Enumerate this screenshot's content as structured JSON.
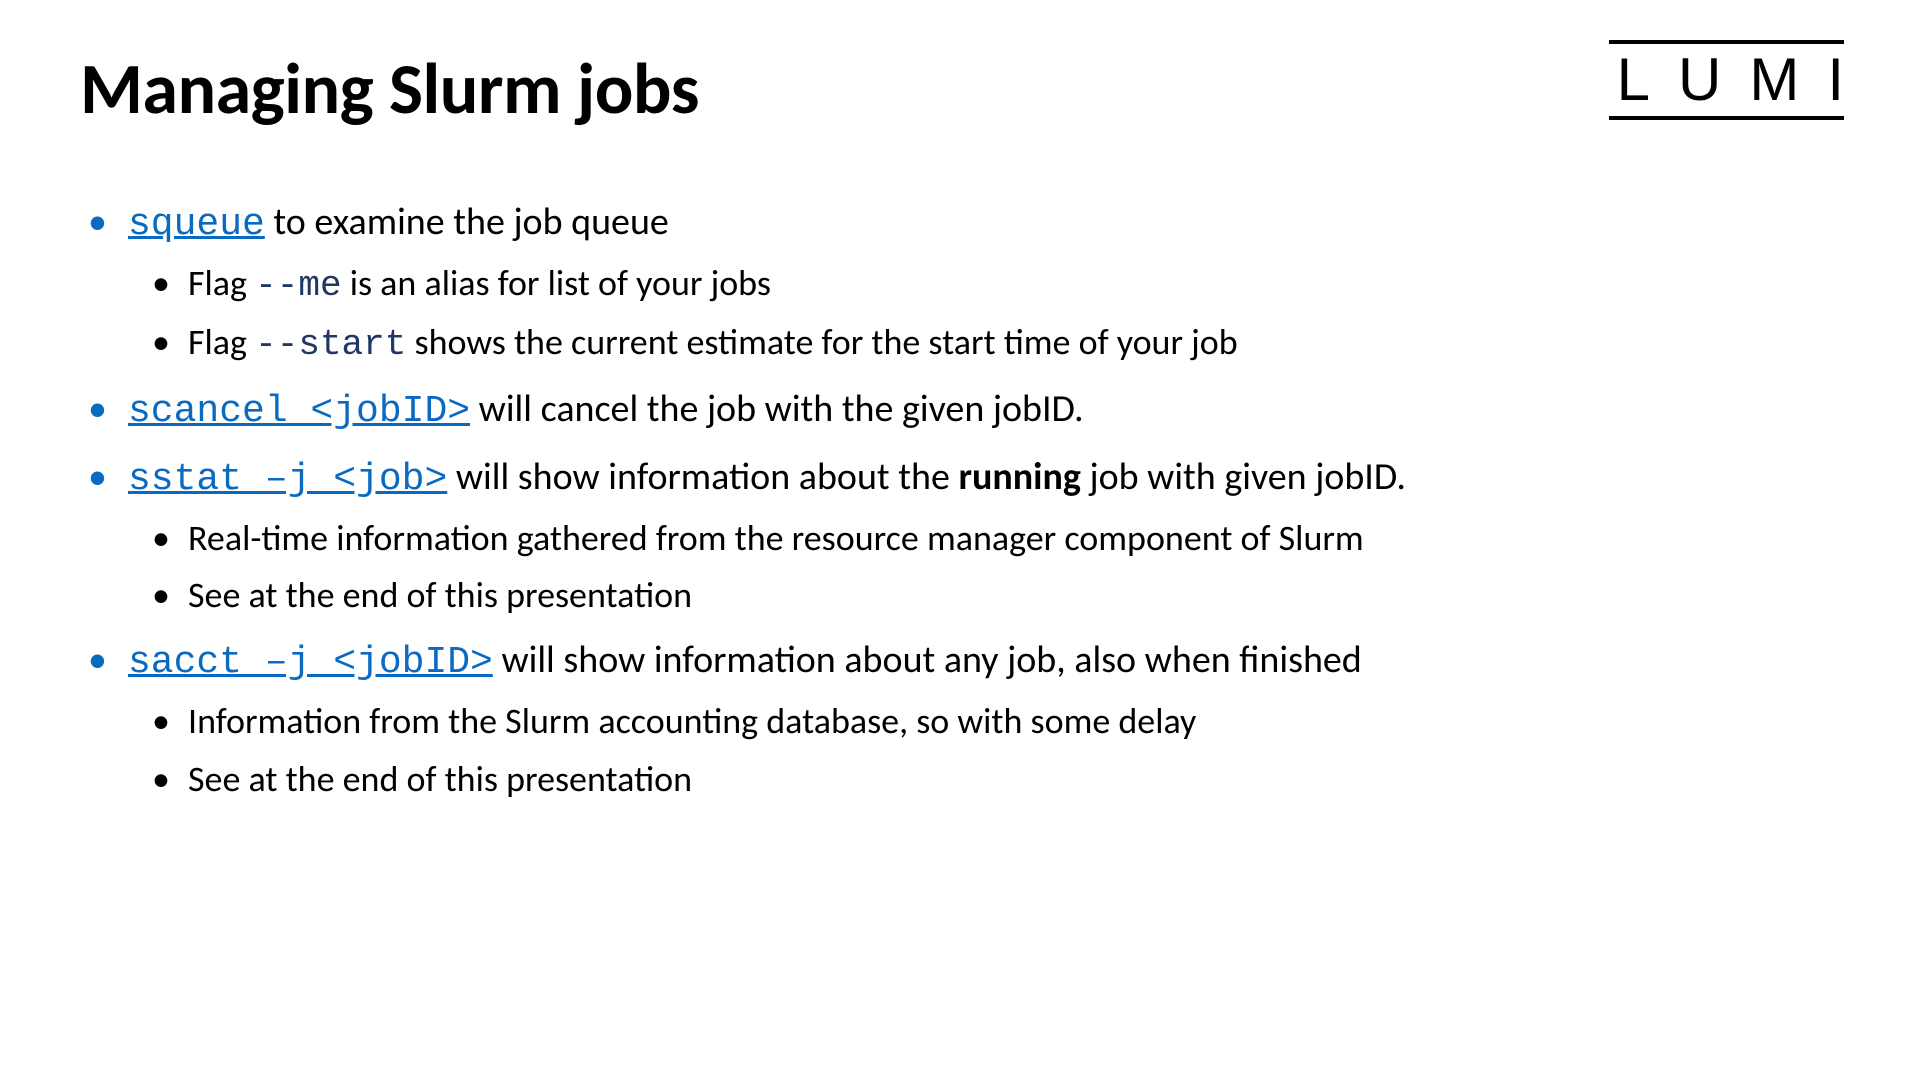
{
  "logo": "LUMI",
  "title": "Managing Slurm jobs",
  "b1": {
    "cmd": "squeue",
    "txt": " to examine the job queue",
    "sub": [
      {
        "pre": "Flag ",
        "code": "--me",
        "post": " is an alias for list of your jobs"
      },
      {
        "pre": "Flag ",
        "code": "--start",
        "post": " shows  the current estimate for the start time of your job"
      }
    ]
  },
  "b2": {
    "cmd": "scancel <jobID>",
    "txt": " will cancel the job with the given jobID."
  },
  "b3": {
    "cmd": "sstat –j <job>",
    "pre": " will show information about the ",
    "bold": "running",
    "post": " job with given jobID.",
    "sub": [
      "Real-time information gathered from the resource manager component of Slurm",
      "See at the end of this presentation"
    ]
  },
  "b4": {
    "cmd": "sacct –j <jobID>",
    "txt": " will show information about any job, also when finished",
    "sub": [
      "Information from the Slurm accounting database, so with some delay",
      "See at the end of this presentation"
    ]
  }
}
